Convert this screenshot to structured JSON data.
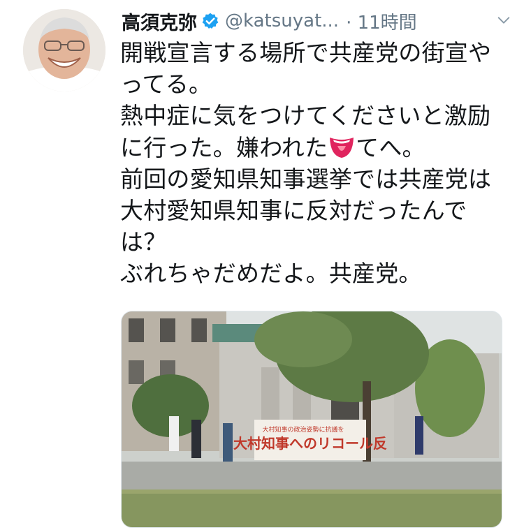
{
  "tweet": {
    "author_name": "高須克弥",
    "handle": "@katsuyat...",
    "time": "· 11時間",
    "lines": [
      "開戦宣言する場所で共産党の街宣や",
      "ってる。",
      "熱中症に気をつけてくださいと激励",
      "に行った。嫌われた",
      "てへ。",
      "前回の愛知県知事選挙では共産党は",
      "大村愛知県知事に反対だったんで",
      "は？",
      "ぶれちゃだめだよ。共産党。"
    ]
  },
  "photo": {
    "banner_text": "大村知事へのリコール反",
    "banner_small": "大村知事の政治姿勢に抗議を"
  },
  "colors": {
    "verified": "#1da1f2",
    "text": "#14171a",
    "secondary": "#657786",
    "emoji": "#e0245e"
  },
  "icons": {
    "verified": "verified-badge-icon",
    "menu": "chevron-down-icon",
    "emoji": "tongue-face-emoji-icon"
  }
}
